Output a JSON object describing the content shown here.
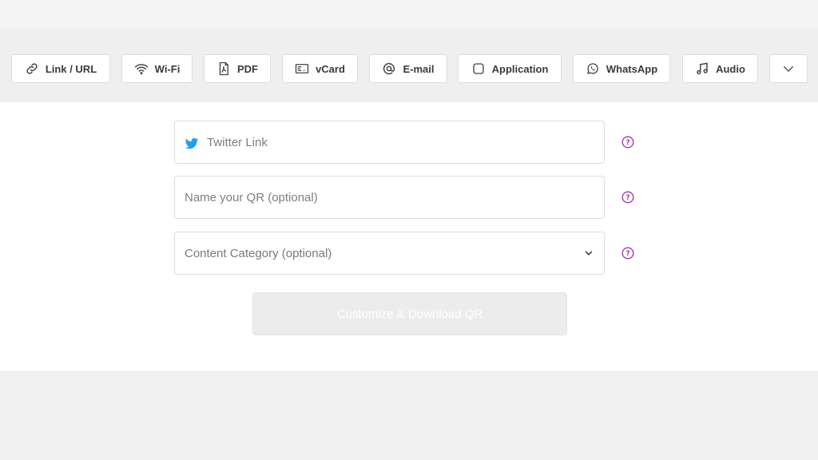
{
  "toolbar": {
    "items": [
      {
        "label": "Link / URL",
        "icon": "link-icon"
      },
      {
        "label": "Wi-Fi",
        "icon": "wifi-icon"
      },
      {
        "label": "PDF",
        "icon": "pdf-icon"
      },
      {
        "label": "vCard",
        "icon": "vcard-icon"
      },
      {
        "label": "E-mail",
        "icon": "at-icon"
      },
      {
        "label": "Application",
        "icon": "app-icon"
      },
      {
        "label": "WhatsApp",
        "icon": "whatsapp-icon"
      },
      {
        "label": "Audio",
        "icon": "music-note-icon"
      }
    ],
    "more_icon": "chevron-down-icon"
  },
  "form": {
    "twitter_link": {
      "placeholder": "Twitter Link",
      "value": "",
      "icon": "twitter-icon"
    },
    "qr_name": {
      "placeholder": "Name your QR (optional)",
      "value": ""
    },
    "content_category": {
      "selected": "Content Category (optional)",
      "icon": "chevron-down-icon"
    },
    "help_icon": "help-icon",
    "submit_label": "Customize & Download QR"
  },
  "colors": {
    "accent_help": "#9b3fa6",
    "twitter_blue": "#1da1f2",
    "button_disabled_bg": "#ececec"
  }
}
